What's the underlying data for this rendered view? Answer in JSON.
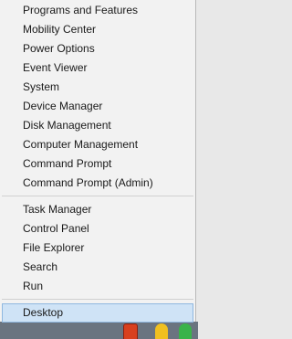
{
  "menu": {
    "group1": [
      {
        "label": "Programs and Features"
      },
      {
        "label": "Mobility Center"
      },
      {
        "label": "Power Options"
      },
      {
        "label": "Event Viewer"
      },
      {
        "label": "System"
      },
      {
        "label": "Device Manager"
      },
      {
        "label": "Disk Management"
      },
      {
        "label": "Computer Management"
      },
      {
        "label": "Command Prompt"
      },
      {
        "label": "Command Prompt (Admin)"
      }
    ],
    "group2": [
      {
        "label": "Task Manager"
      },
      {
        "label": "Control Panel"
      },
      {
        "label": "File Explorer"
      },
      {
        "label": "Search"
      },
      {
        "label": "Run"
      }
    ],
    "group3": [
      {
        "label": "Desktop",
        "selected": true
      }
    ]
  },
  "colors": {
    "menu_background": "#f2f2f2",
    "selection_background": "#cfe3f6",
    "selection_border": "#8fb8e0",
    "taskbar": "#6a7480"
  },
  "taskbar": {
    "icons": [
      "app-icon-red",
      "app-icon-yellow",
      "chrome-icon"
    ]
  }
}
